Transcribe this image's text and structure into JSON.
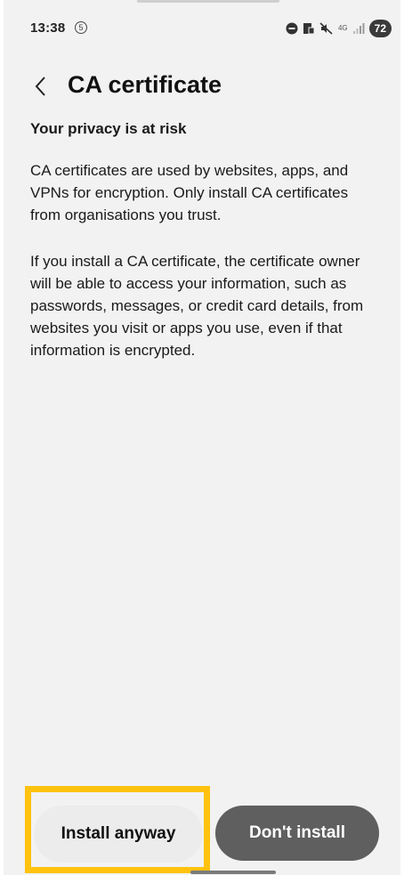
{
  "status_bar": {
    "time": "13:38",
    "dnd_glyph": "④",
    "network": "4G",
    "battery": "72"
  },
  "header": {
    "title": "CA certificate"
  },
  "content": {
    "subheading": "Your privacy is at risk",
    "paragraphs": [
      "CA certificates are used by websites, apps, and VPNs for encryption. Only install CA certificates from organisations you trust.",
      "If you install a CA certificate, the certificate owner will be able to access your information, such as passwords, messages, or credit card details, from websites you visit or apps you use, even if that information is encrypted."
    ]
  },
  "buttons": {
    "install_anyway": "Install anyway",
    "dont_install": "Don't install"
  },
  "colors": {
    "highlight": "#ffc20e",
    "dont_install_bg": "#5f5f5f",
    "background": "#f2f2f2"
  }
}
